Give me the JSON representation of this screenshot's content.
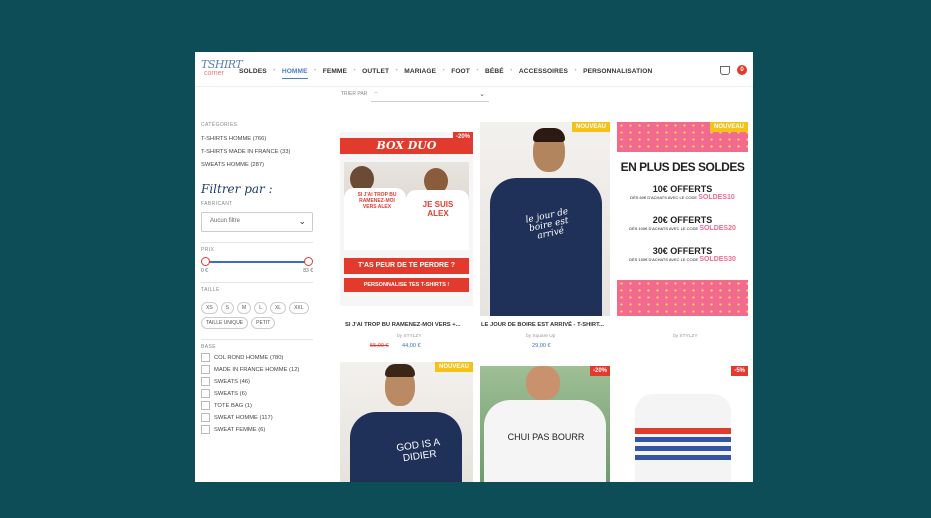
{
  "header": {
    "logo_top": "TSHIRT",
    "logo_bottom": "corner",
    "nav": [
      "SOLDES",
      "HOMME",
      "FEMME",
      "OUTLET",
      "MARIAGE",
      "FOOT",
      "BÉBÉ",
      "ACCESSOIRES",
      "PERSONNALISATION"
    ],
    "active": "HOMME",
    "cart_count": "0"
  },
  "sort": {
    "label": "TRIER PAR",
    "value": "--"
  },
  "sidebar": {
    "categories_title": "CATÉGORIES",
    "categories": [
      "T-SHIRTS HOMME (766)",
      "T-SHIRTS MADE IN FRANCE (33)",
      "SWEATS HOMME (287)"
    ],
    "filter_title": "Filtrer par :",
    "fabricant_label": "FABRICANT",
    "fabricant_value": "Aucun filtre",
    "prix_label": "PRIX",
    "prix_min": "0 €",
    "prix_max": "83 €",
    "taille_label": "TAILLE",
    "sizes": [
      "XS",
      "S",
      "M",
      "L",
      "XL",
      "XXL",
      "TAILLE UNIQUE",
      "PETIT"
    ],
    "base_label": "BASE",
    "bases": [
      "COL ROND HOMME (780)",
      "MADE IN FRANCE HOMME (12)",
      "SWEATS (46)",
      "SWEATS (6)",
      "TOTE BAG (1)",
      "SWEAT HOMME (117)",
      "SWEAT FEMME (6)"
    ]
  },
  "products": [
    {
      "badge": "-20%",
      "banner_title": "BOX DUO",
      "shirt1_text": "SI J'AI TROP BU RAMENEZ-MOI VERS ALEX",
      "shirt2_text": "JE SUIS ALEX",
      "cta1": "T'AS PEUR DE TE PERDRE ?",
      "cta2": "PERSONNALISE TES T-SHIRTS !",
      "title": "SI J'AI TROP BU RAMENEZ-MOI VERS +...",
      "by": "by STYLZY",
      "old_price": "55,00 €",
      "price": "44,00 €"
    },
    {
      "badge": "NOUVEAU",
      "shirt_text": "le jour de boire est arrivé",
      "title": "LE JOUR DE BOIRE EST ARRIVÉ - T-SHIRT...",
      "by": "by Square Up",
      "price": "29,00 €"
    },
    {
      "badge": "NOUVEAU",
      "headline": "EN PLUS DES SOLDES",
      "offers": [
        {
          "big": "10€ OFFERTS",
          "small": "DÈS 60€ D'ACHATS AVEC LE CODE",
          "code": "SOLDES10"
        },
        {
          "big": "20€ OFFERTS",
          "small": "DÈS 100€ D'ACHATS AVEC LE CODE",
          "code": "SOLDES20"
        },
        {
          "big": "30€ OFFERTS",
          "small": "DÈS 150€ D'ACHATS AVEC LE CODE",
          "code": "SOLDES30"
        }
      ],
      "by": "by STYLZY"
    },
    {
      "badge": "NOUVEAU",
      "shirt_text": "GOD IS A DIDIER"
    },
    {
      "badge": "-20%",
      "shirt_text": "CHUI PAS BOURR"
    },
    {
      "badge": "-5%"
    }
  ],
  "colors": {
    "background": "#0d4d57",
    "accent": "#3d6fbf",
    "sale": "#e23b2e",
    "new": "#f3c21b"
  }
}
